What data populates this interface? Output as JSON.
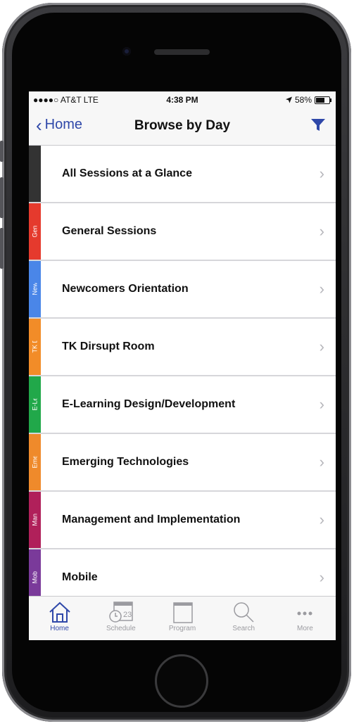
{
  "status_bar": {
    "carrier": "●●●●○ AT&T  LTE",
    "time": "4:38 PM",
    "battery": "58%",
    "icons": [
      "location-arrow-icon",
      "battery-icon"
    ]
  },
  "navbar": {
    "back_label": "Home",
    "title": "Browse by Day",
    "filter_icon": "filter-icon"
  },
  "rows": [
    {
      "label": "All Sessions at a Glance",
      "tag": "",
      "color": "#333333"
    },
    {
      "label": "General Sessions",
      "tag": "General Sessi..",
      "color": "#e53a2d"
    },
    {
      "label": "Newcomers Orientation",
      "tag": "Newcomers",
      "color": "#4a86e8"
    },
    {
      "label": "TK Dirsupt Room",
      "tag": "TK Dirsupt Ro..",
      "color": "#f28c28"
    },
    {
      "label": "E-Learning Design/Development",
      "tag": "E-Learning De..",
      "color": "#21a84a"
    },
    {
      "label": "Emerging Technologies",
      "tag": "Emerging Tec..",
      "color": "#ef8a2b"
    },
    {
      "label": "Management and Implementation",
      "tag": "Management",
      "color": "#b0205a"
    },
    {
      "label": "Mobile",
      "tag": "Mobile",
      "color": "#7a3a9a"
    }
  ],
  "tabbar": {
    "tabs": [
      {
        "label": "Home",
        "icon": "home-icon",
        "active": true
      },
      {
        "label": "Schedule",
        "icon": "calendar-icon",
        "badge": "23",
        "active": false
      },
      {
        "label": "Program",
        "icon": "program-icon",
        "active": false
      },
      {
        "label": "Search",
        "icon": "search-icon",
        "active": false
      },
      {
        "label": "More",
        "icon": "more-icon",
        "active": false
      }
    ]
  },
  "colors": {
    "accent": "#2f48a9",
    "chevron": "#b6b6bb"
  }
}
